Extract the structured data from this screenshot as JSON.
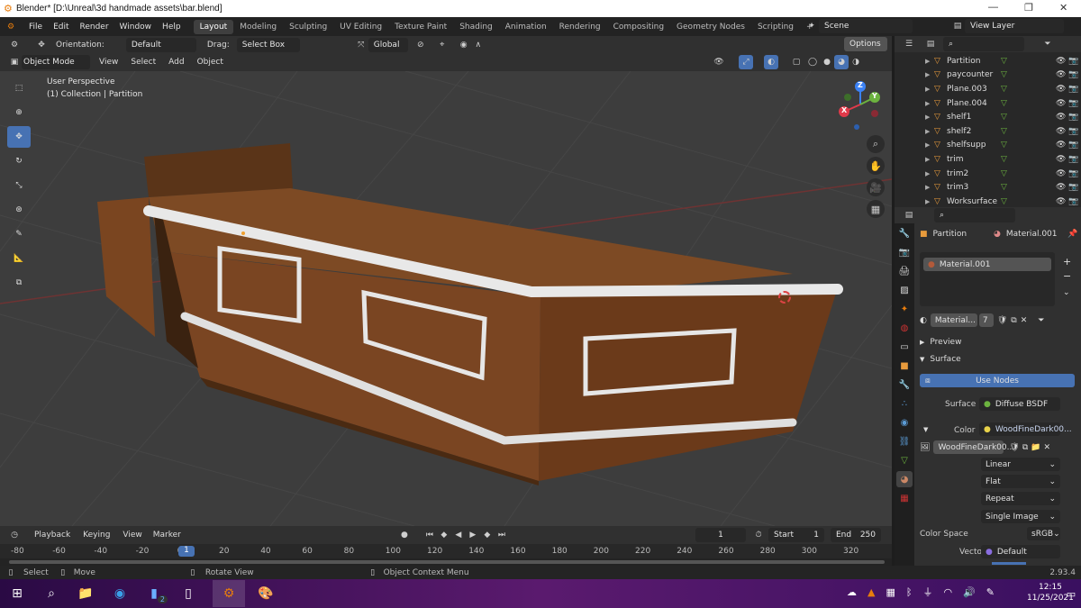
{
  "window": {
    "title": "Blender* [D:\\Unreal\\3d handmade assets\\bar.blend]"
  },
  "menu": {
    "items": [
      "File",
      "Edit",
      "Render",
      "Window",
      "Help"
    ]
  },
  "workspaces": [
    "Layout",
    "Modeling",
    "Sculpting",
    "UV Editing",
    "Texture Paint",
    "Shading",
    "Animation",
    "Rendering",
    "Compositing",
    "Geometry Nodes",
    "Scripting"
  ],
  "scene": {
    "name": "Scene",
    "view_layer": "View Layer"
  },
  "tool_header": {
    "orientation_label": "Orientation:",
    "orientation_value": "Default",
    "drag_label": "Drag:",
    "drag_value": "Select Box",
    "transform_orientation": "Global",
    "options": "Options"
  },
  "viewport_header": {
    "mode": "Object Mode",
    "menus": [
      "View",
      "Select",
      "Add",
      "Object"
    ]
  },
  "viewport": {
    "perspective": "User Perspective",
    "collection": "(1) Collection | Partition"
  },
  "gizmo": {
    "z": "Z",
    "y": "Y",
    "x": "X"
  },
  "timeline": {
    "menus": [
      "Playback",
      "Keying",
      "View",
      "Marker"
    ],
    "current": "1",
    "start_label": "Start",
    "start": "1",
    "end_label": "End",
    "end": "250",
    "ticks": [
      "-80",
      "-60",
      "-40",
      "-20",
      "0",
      "20",
      "40",
      "60",
      "80",
      "100",
      "120",
      "140",
      "160",
      "180",
      "200",
      "220",
      "240",
      "260",
      "280",
      "300",
      "320"
    ],
    "frame_marker": "1"
  },
  "status_bar": {
    "select": "Select",
    "move": "Move",
    "rotate": "Rotate View",
    "context": "Object Context Menu",
    "version": "2.93.4"
  },
  "outliner": {
    "items": [
      "Partition",
      "paycounter",
      "Plane.003",
      "Plane.004",
      "shelf1",
      "shelf2",
      "shelfsupp",
      "trim",
      "trim2",
      "trim3",
      "Worksurface"
    ]
  },
  "properties": {
    "object": "Partition",
    "material_name": "Material.001",
    "slot": "Material.001",
    "mat_field": "Material...",
    "users": "7",
    "preview": "Preview",
    "surface_panel": "Surface",
    "use_nodes": "Use Nodes",
    "surface_label": "Surface",
    "surface_value": "Diffuse BSDF",
    "color_label": "Color",
    "color_value": "WoodFineDark00...",
    "image_name": "WoodFineDark00...",
    "interp": "Linear",
    "proj": "Flat",
    "ext": "Repeat",
    "source": "Single Image",
    "colorspace_label": "Color Space",
    "colorspace_value": "sRGB",
    "vector_label": "Vector",
    "vector_value": "Default"
  },
  "taskbar": {
    "time": "12:15",
    "date": "11/25/2021",
    "badge": "2"
  }
}
